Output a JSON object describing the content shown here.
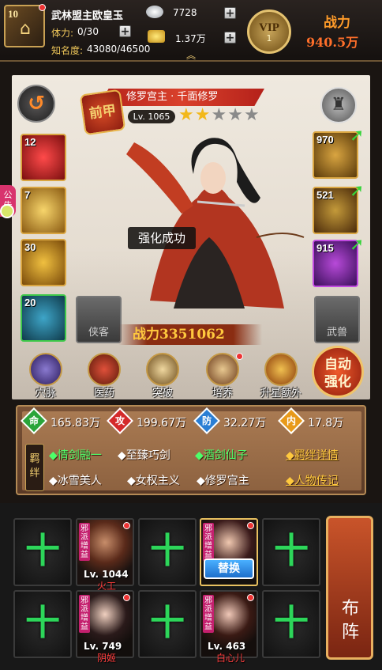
{
  "player": {
    "level": "10",
    "name": "武林盟主欧皇玉",
    "stamina_label": "体力:",
    "stamina": "0/30",
    "fame_label": "知名度:",
    "fame": "43080/46500"
  },
  "currency": {
    "silver": "7728",
    "gold": "1.37万"
  },
  "vip": {
    "label": "VIP",
    "level": "1"
  },
  "power": {
    "label": "战力",
    "value": "940.5万"
  },
  "hero": {
    "title": "修罗宫主 · 千面修罗",
    "seal": "前甲",
    "level": "Lv. 1065",
    "stars": 2,
    "max_stars": 5,
    "power_label": "战力",
    "power": "3351062"
  },
  "toast": "强化成功",
  "left_slots": [
    {
      "count": "12"
    },
    {
      "count": "7"
    },
    {
      "count": "30"
    },
    {
      "count": "20"
    }
  ],
  "right_slots": [
    {
      "count": "970"
    },
    {
      "count": "521"
    },
    {
      "count": "915"
    }
  ],
  "empty_slots": {
    "left": "侠客",
    "right": "武兽"
  },
  "side_tag": "公告",
  "functions": [
    {
      "label": "穴脉",
      "icon": "meridian-icon"
    },
    {
      "label": "医药",
      "icon": "medicine-icon"
    },
    {
      "label": "突破",
      "icon": "breakthrough-icon"
    },
    {
      "label": "培养",
      "icon": "train-icon"
    },
    {
      "label": "升星额外",
      "icon": "star-up-icon"
    }
  ],
  "auto_button": {
    "line1": "自动",
    "line2": "强化"
  },
  "stats": [
    {
      "icon": "命",
      "value": "165.83万",
      "color": "#2aa53a"
    },
    {
      "icon": "攻",
      "value": "199.67万",
      "color": "#d42a2a"
    },
    {
      "icon": "防",
      "value": "32.27万",
      "color": "#2a7ed4"
    },
    {
      "icon": "内",
      "value": "17.8万",
      "color": "#e89a1a"
    }
  ],
  "bonds": {
    "tag": "羁绊",
    "row1": [
      {
        "text": "◆情剑融一",
        "active": true
      },
      {
        "text": "◆至臻巧剑",
        "active": false
      },
      {
        "text": "◆酒剑仙子",
        "active": true
      }
    ],
    "row2": [
      {
        "text": "◆冰雪美人",
        "active": false
      },
      {
        "text": "◆女权主义",
        "active": false
      },
      {
        "text": "◆修罗宫主",
        "active": false
      }
    ],
    "detail_link": "◆羁绊详情",
    "bio_link": "◆人物传记"
  },
  "formation": {
    "tag": "邪派增益",
    "heroes": [
      {
        "level": "Lv. 1044",
        "name": "火工"
      },
      {
        "level": "Lv. 749",
        "name": "阴姬"
      },
      {
        "level": "Lv. 463",
        "name": "白心儿"
      }
    ],
    "swap_label": "替换",
    "plus": "十",
    "deploy_line1": "布",
    "deploy_line2": "阵"
  }
}
